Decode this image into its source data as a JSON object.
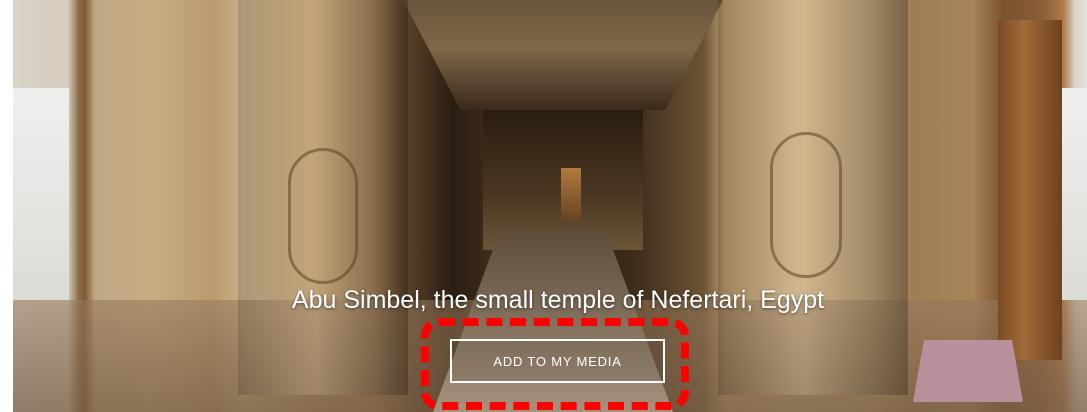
{
  "hero": {
    "title": "Abu Simbel, the small temple of Nefertari, Egypt",
    "add_button_label": "ADD TO MY MEDIA"
  },
  "colors": {
    "title_text": "#ffffff",
    "button_border": "#ffffff",
    "highlight": "#ff0000"
  }
}
